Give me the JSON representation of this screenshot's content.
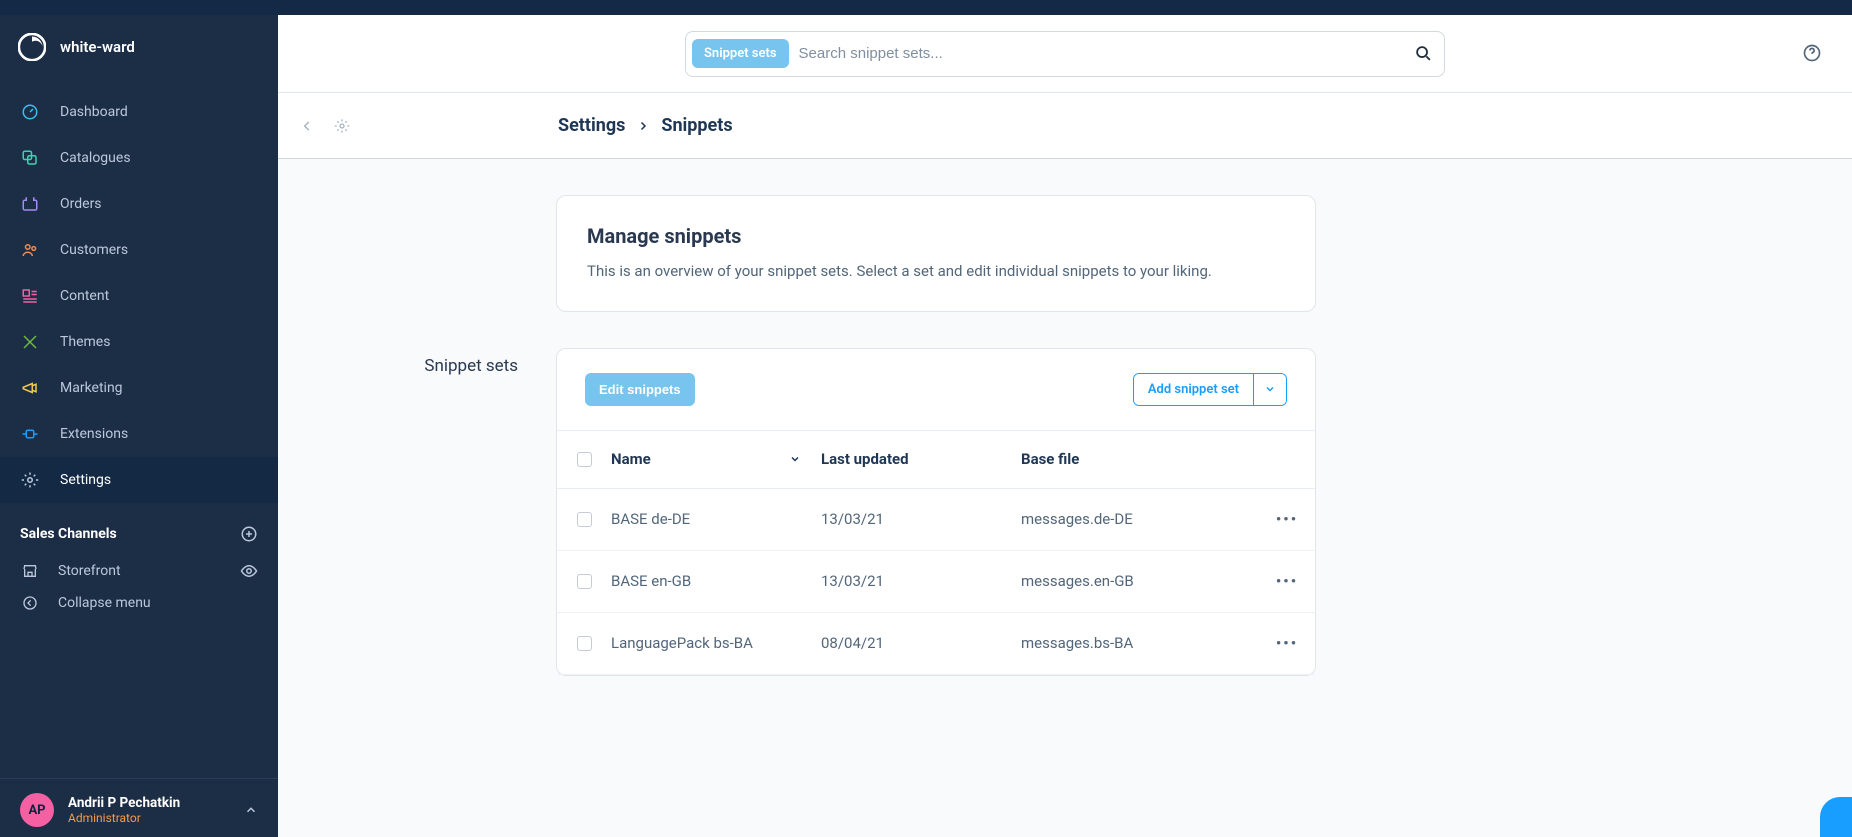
{
  "brand": {
    "name": "white-ward"
  },
  "nav": {
    "items": [
      {
        "id": "dashboard",
        "label": "Dashboard"
      },
      {
        "id": "catalogues",
        "label": "Catalogues"
      },
      {
        "id": "orders",
        "label": "Orders"
      },
      {
        "id": "customers",
        "label": "Customers"
      },
      {
        "id": "content",
        "label": "Content"
      },
      {
        "id": "themes",
        "label": "Themes"
      },
      {
        "id": "marketing",
        "label": "Marketing"
      },
      {
        "id": "extensions",
        "label": "Extensions"
      },
      {
        "id": "settings",
        "label": "Settings"
      }
    ],
    "active": "settings"
  },
  "sales_channels": {
    "title": "Sales Channels",
    "items": [
      {
        "id": "storefront",
        "label": "Storefront"
      }
    ],
    "collapse_label": "Collapse menu"
  },
  "user": {
    "initials": "AP",
    "name": "Andrii P Pechatkin",
    "role": "Administrator"
  },
  "search": {
    "chip": "Snippet sets",
    "placeholder": "Search snippet sets..."
  },
  "breadcrumb": {
    "parent": "Settings",
    "current": "Snippets"
  },
  "intro": {
    "title": "Manage snippets",
    "description": "This is an overview of your snippet sets. Select a set and edit individual snippets to your liking."
  },
  "section": {
    "label": "Snippet sets"
  },
  "toolbar": {
    "edit_label": "Edit snippets",
    "add_label": "Add snippet set"
  },
  "grid": {
    "columns": {
      "name": "Name",
      "updated": "Last updated",
      "base": "Base file"
    },
    "rows": [
      {
        "name": "BASE de-DE",
        "updated": "13/03/21",
        "base": "messages.de-DE"
      },
      {
        "name": "BASE en-GB",
        "updated": "13/03/21",
        "base": "messages.en-GB"
      },
      {
        "name": "LanguagePack bs-BA",
        "updated": "08/04/21",
        "base": "messages.bs-BA"
      }
    ]
  }
}
